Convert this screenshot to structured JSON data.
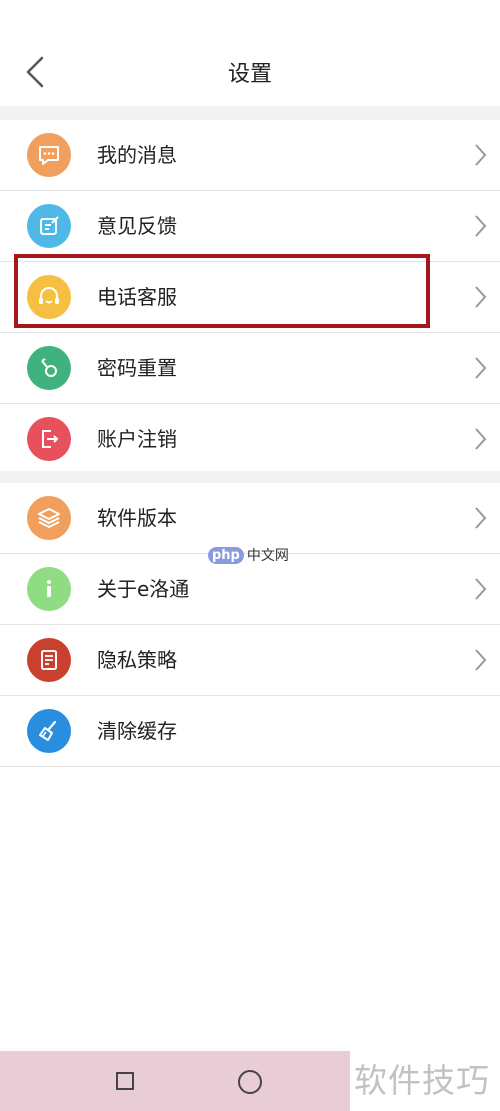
{
  "header": {
    "title": "设置"
  },
  "group1": [
    {
      "label": "我的消息",
      "icon": "message-icon",
      "color": "#f0a05c"
    },
    {
      "label": "意见反馈",
      "icon": "feedback-edit-icon",
      "color": "#4fb8e6"
    },
    {
      "label": "电话客服",
      "icon": "headset-icon",
      "color": "#f5c042"
    },
    {
      "label": "密码重置",
      "icon": "key-icon",
      "color": "#3fb27f"
    },
    {
      "label": "账户注销",
      "icon": "logout-icon",
      "color": "#e8505b"
    }
  ],
  "group2": [
    {
      "label": "软件版本",
      "icon": "layers-icon",
      "color": "#f0a05c"
    },
    {
      "label": "关于e洛通",
      "icon": "info-icon",
      "color": "#8fdc83"
    },
    {
      "label": "隐私策略",
      "icon": "document-icon",
      "color": "#c9402e"
    },
    {
      "label": "清除缓存",
      "icon": "broom-icon",
      "color": "#2a8ee0"
    }
  ],
  "watermark": {
    "logo_tag": "php",
    "logo_text": "中文网",
    "corner_text": "软件技巧"
  },
  "colors": {
    "highlight_border": "#a3171d",
    "nav_bar_bg": "#e8cdd6"
  }
}
